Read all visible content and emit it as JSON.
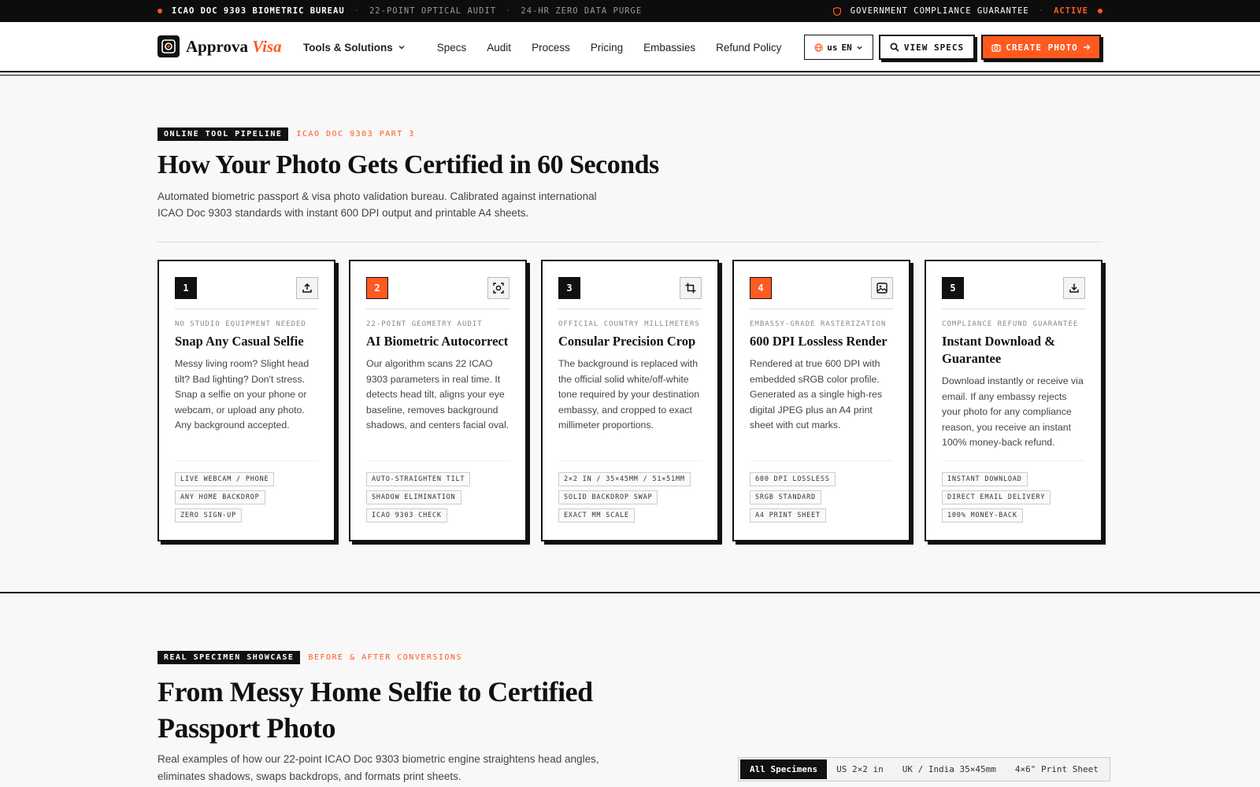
{
  "topbar": {
    "brand": "ICAO DOC 9303 BIOMETRIC BUREAU",
    "items": [
      "22-POINT OPTICAL AUDIT",
      "24-HR ZERO DATA PURGE"
    ],
    "guarantee": "GOVERNMENT COMPLIANCE GUARANTEE",
    "status": "ACTIVE"
  },
  "nav": {
    "logo_main": "Approva",
    "logo_accent": "Visa",
    "dropdown": "Tools & Solutions",
    "links": [
      "Specs",
      "Audit",
      "Process",
      "Pricing",
      "Embassies",
      "Refund Policy"
    ],
    "lang_flag": "us",
    "lang": "EN",
    "view_specs": "VIEW SPECS",
    "create_photo": "CREATE PHOTO"
  },
  "pipeline": {
    "tag": "ONLINE TOOL PIPELINE",
    "subtag": "ICAO DOC 9303 PART 3",
    "title": "How Your Photo Gets Certified in 60 Seconds",
    "lede": "Automated biometric passport & visa photo validation bureau. Calibrated against international ICAO Doc 9303 standards with instant 600 DPI output and printable A4 sheets.",
    "cards": [
      {
        "num": "1",
        "icon": "upload-icon",
        "kicker": "NO STUDIO EQUIPMENT NEEDED",
        "title": "Snap Any Casual Selfie",
        "body": "Messy living room? Slight head tilt? Bad lighting? Don't stress. Snap a selfie on your phone or webcam, or upload any photo. Any background accepted.",
        "tags": [
          "LIVE WEBCAM / PHONE",
          "ANY HOME BACKDROP",
          "ZERO SIGN-UP"
        ]
      },
      {
        "num": "2",
        "icon": "scan-face-icon",
        "kicker": "22-POINT GEOMETRY AUDIT",
        "title": "AI Biometric Autocorrect",
        "body": "Our algorithm scans 22 ICAO 9303 parameters in real time. It detects head tilt, aligns your eye baseline, removes background shadows, and centers facial oval.",
        "tags": [
          "AUTO-STRAIGHTEN TILT",
          "SHADOW ELIMINATION",
          "ICAO 9303 CHECK"
        ]
      },
      {
        "num": "3",
        "icon": "crop-icon",
        "kicker": "OFFICIAL COUNTRY MILLIMETERS",
        "title": "Consular Precision Crop",
        "body": "The background is replaced with the official solid white/off-white tone required by your destination embassy, and cropped to exact millimeter proportions.",
        "tags": [
          "2×2 IN / 35×45MM / 51×51MM",
          "SOLID BACKDROP SWAP",
          "EXACT MM SCALE"
        ]
      },
      {
        "num": "4",
        "icon": "image-icon",
        "kicker": "EMBASSY-GRADE RASTERIZATION",
        "title": "600 DPI Lossless Render",
        "body": "Rendered at true 600 DPI with embedded sRGB color profile. Generated as a single high-res digital JPEG plus an A4 print sheet with cut marks.",
        "tags": [
          "600 DPI LOSSLESS",
          "SRGB STANDARD",
          "A4 PRINT SHEET"
        ]
      },
      {
        "num": "5",
        "icon": "download-icon",
        "kicker": "COMPLIANCE REFUND GUARANTEE",
        "title": "Instant Download & Guarantee",
        "body": "Download instantly or receive via email. If any embassy rejects your photo for any compliance reason, you receive an instant 100% money-back refund.",
        "tags": [
          "INSTANT DOWNLOAD",
          "DIRECT EMAIL DELIVERY",
          "100% MONEY-BACK"
        ]
      }
    ]
  },
  "showcase": {
    "tag": "REAL SPECIMEN SHOWCASE",
    "subtag": "BEFORE & AFTER CONVERSIONS",
    "title": "From Messy Home Selfie to Certified Passport Photo",
    "lede": "Real examples of how our 22-point ICAO Doc 9303 biometric engine straightens head angles, eliminates shadows, swaps backdrops, and formats print sheets.",
    "filters": [
      "All Specimens",
      "US 2×2 in",
      "UK / India 35×45mm",
      "4×6\" Print Sheet"
    ],
    "active_filter": "All Specimens"
  },
  "colors": {
    "accent": "#ff5a1f",
    "ink": "#111111",
    "bg": "#f8f8f8"
  }
}
